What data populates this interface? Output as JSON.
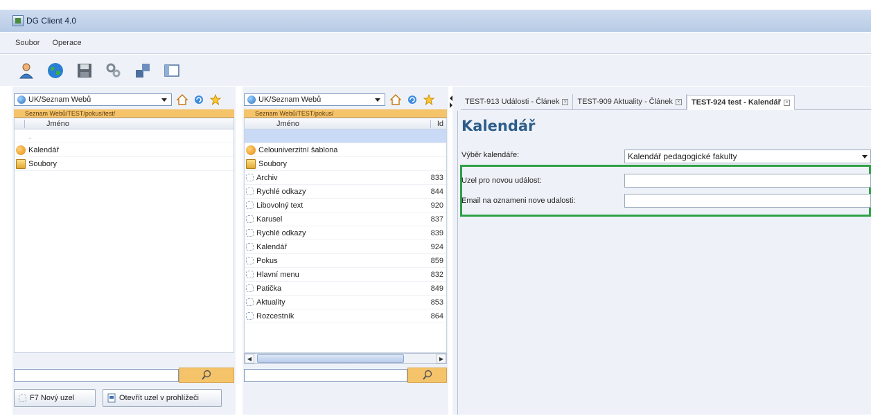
{
  "window": {
    "title": "DG Client 4.0"
  },
  "menu": {
    "items": [
      "Soubor",
      "Operace"
    ]
  },
  "toolbar": {
    "icons": [
      "user-icon",
      "globe-icon",
      "save-icon",
      "settings-icon",
      "windows-icon",
      "panel-icon"
    ]
  },
  "left_pane": {
    "site_selector": "UK/Seznam Webů",
    "path": "Seznam Webů/TEST/pokus/test/",
    "column_name": "Jméno",
    "rows": [
      {
        "name": "..",
        "icon": "none"
      },
      {
        "name": "Kalendář",
        "icon": "orange-ball-icon"
      },
      {
        "name": "Soubory",
        "icon": "folder-icon"
      }
    ],
    "search_value": "",
    "buttons": {
      "new_node": "F7 Nový uzel",
      "open_in_browser": "Otevřít uzel v prohlížeči"
    }
  },
  "middle_pane": {
    "site_selector": "UK/Seznam Webů",
    "path": "Seznam Webů/TEST/pokus/",
    "column_name": "Jméno",
    "column_id": "Id",
    "rows": [
      {
        "name": "",
        "id": "",
        "icon": "none"
      },
      {
        "name": "Celouniverzitní šablona",
        "id": "",
        "icon": "orange-ball-icon"
      },
      {
        "name": "Soubory",
        "id": "",
        "icon": "folder-icon"
      },
      {
        "name": "Archiv",
        "id": "833",
        "icon": "node-icon"
      },
      {
        "name": "Rychlé odkazy",
        "id": "844",
        "icon": "node-icon"
      },
      {
        "name": "Libovolný text",
        "id": "920",
        "icon": "node-icon"
      },
      {
        "name": "Karusel",
        "id": "837",
        "icon": "node-icon"
      },
      {
        "name": "Rychlé odkazy",
        "id": "839",
        "icon": "node-icon"
      },
      {
        "name": "Kalendář",
        "id": "924",
        "icon": "node-icon"
      },
      {
        "name": "Pokus",
        "id": "859",
        "icon": "node-icon"
      },
      {
        "name": "Hlavní menu",
        "id": "832",
        "icon": "node-icon"
      },
      {
        "name": "Patička",
        "id": "849",
        "icon": "node-icon"
      },
      {
        "name": "Aktuality",
        "id": "853",
        "icon": "node-icon"
      },
      {
        "name": "Rozcestník",
        "id": "864",
        "icon": "node-icon"
      }
    ],
    "search_value": ""
  },
  "editor": {
    "tabs": [
      {
        "label": "TEST-913 Události - Článek",
        "active": false
      },
      {
        "label": "TEST-909 Aktuality - Článek",
        "active": false
      },
      {
        "label": "TEST-924 test - Kalendář",
        "active": true
      }
    ],
    "title": "Kalendář",
    "fields": {
      "calendar_select": {
        "label": "Výběr kalendáře:",
        "value": "Kalendář pedagogické fakulty"
      },
      "event_node": {
        "label": "Uzel pro novou událost:",
        "value": ""
      },
      "notify_email": {
        "label": "Email na oznameni nove udalosti:",
        "value": ""
      }
    },
    "highlight_color": "#2e9f46"
  },
  "colors": {
    "path_bar": "#f5c46a",
    "title": "#2d5c8a",
    "panel_bg": "#eef2f8"
  }
}
